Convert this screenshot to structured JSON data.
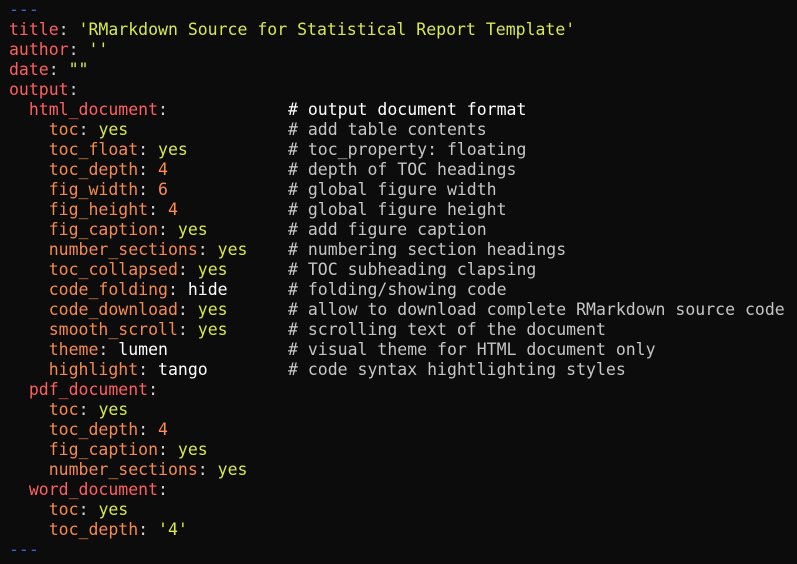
{
  "editor": {
    "lines": [
      {
        "segs": [
          {
            "t": "---",
            "c": "sep"
          }
        ]
      },
      {
        "segs": [
          {
            "t": "title",
            "c": "k"
          },
          {
            "t": ": ",
            "c": "p"
          },
          {
            "t": "'RMarkdown Source for Statistical Report Template'",
            "c": "s"
          }
        ]
      },
      {
        "segs": [
          {
            "t": "author",
            "c": "k"
          },
          {
            "t": ": ",
            "c": "p"
          },
          {
            "t": "''",
            "c": "s"
          }
        ]
      },
      {
        "segs": [
          {
            "t": "date",
            "c": "k"
          },
          {
            "t": ": ",
            "c": "p"
          },
          {
            "t": "\"\"",
            "c": "s"
          }
        ]
      },
      {
        "segs": [
          {
            "t": "output",
            "c": "k"
          },
          {
            "t": ":",
            "c": "p"
          }
        ]
      },
      {
        "segs": [
          {
            "t": "  ",
            "c": "p"
          },
          {
            "t": "html_document",
            "c": "k"
          },
          {
            "t": ":",
            "c": "p"
          }
        ],
        "comment": "# output document format",
        "bright": true
      },
      {
        "segs": [
          {
            "t": "    ",
            "c": "p"
          },
          {
            "t": "toc",
            "c": "k2"
          },
          {
            "t": ": ",
            "c": "p"
          },
          {
            "t": "yes",
            "c": "b"
          }
        ],
        "comment": "# add table contents"
      },
      {
        "segs": [
          {
            "t": "    ",
            "c": "p"
          },
          {
            "t": "toc_float",
            "c": "k2"
          },
          {
            "t": ": ",
            "c": "p"
          },
          {
            "t": "yes",
            "c": "b"
          }
        ],
        "comment": "# toc_property: floating"
      },
      {
        "segs": [
          {
            "t": "    ",
            "c": "p"
          },
          {
            "t": "toc_depth",
            "c": "k2"
          },
          {
            "t": ": ",
            "c": "p"
          },
          {
            "t": "4",
            "c": "n"
          }
        ],
        "comment": "# depth of TOC headings"
      },
      {
        "segs": [
          {
            "t": "    ",
            "c": "p"
          },
          {
            "t": "fig_width",
            "c": "k2"
          },
          {
            "t": ": ",
            "c": "p"
          },
          {
            "t": "6",
            "c": "n"
          }
        ],
        "comment": "# global figure width"
      },
      {
        "segs": [
          {
            "t": "    ",
            "c": "p"
          },
          {
            "t": "fig_height",
            "c": "k2"
          },
          {
            "t": ": ",
            "c": "p"
          },
          {
            "t": "4",
            "c": "n"
          }
        ],
        "comment": "# global figure height"
      },
      {
        "segs": [
          {
            "t": "    ",
            "c": "p"
          },
          {
            "t": "fig_caption",
            "c": "k2"
          },
          {
            "t": ": ",
            "c": "p"
          },
          {
            "t": "yes",
            "c": "b"
          }
        ],
        "comment": "# add figure caption"
      },
      {
        "segs": [
          {
            "t": "    ",
            "c": "p"
          },
          {
            "t": "number_sections",
            "c": "k2"
          },
          {
            "t": ": ",
            "c": "p"
          },
          {
            "t": "yes",
            "c": "b"
          }
        ],
        "comment": "# numbering section headings"
      },
      {
        "segs": [
          {
            "t": "    ",
            "c": "p"
          },
          {
            "t": "toc_collapsed",
            "c": "k2"
          },
          {
            "t": ": ",
            "c": "p"
          },
          {
            "t": "yes",
            "c": "b"
          }
        ],
        "comment": "# TOC subheading clapsing"
      },
      {
        "segs": [
          {
            "t": "    ",
            "c": "p"
          },
          {
            "t": "code_folding",
            "c": "k2"
          },
          {
            "t": ": ",
            "c": "p"
          },
          {
            "t": "hide",
            "c": "w"
          }
        ],
        "comment": "# folding/showing code"
      },
      {
        "segs": [
          {
            "t": "    ",
            "c": "p"
          },
          {
            "t": "code_download",
            "c": "k2"
          },
          {
            "t": ": ",
            "c": "p"
          },
          {
            "t": "yes",
            "c": "b"
          }
        ],
        "comment": "# allow to download complete RMarkdown source code"
      },
      {
        "segs": [
          {
            "t": "    ",
            "c": "p"
          },
          {
            "t": "smooth_scroll",
            "c": "k2"
          },
          {
            "t": ": ",
            "c": "p"
          },
          {
            "t": "yes",
            "c": "b"
          }
        ],
        "comment": "# scrolling text of the document"
      },
      {
        "segs": [
          {
            "t": "    ",
            "c": "p"
          },
          {
            "t": "theme",
            "c": "k2"
          },
          {
            "t": ": ",
            "c": "p"
          },
          {
            "t": "lumen",
            "c": "w"
          }
        ],
        "comment": "# visual theme for HTML document only"
      },
      {
        "segs": [
          {
            "t": "    ",
            "c": "p"
          },
          {
            "t": "highlight",
            "c": "k2"
          },
          {
            "t": ": ",
            "c": "p"
          },
          {
            "t": "tango",
            "c": "w"
          }
        ],
        "comment": "# code syntax hightlighting styles"
      },
      {
        "segs": [
          {
            "t": "  ",
            "c": "p"
          },
          {
            "t": "pdf_document",
            "c": "k"
          },
          {
            "t": ":",
            "c": "p"
          }
        ]
      },
      {
        "segs": [
          {
            "t": "    ",
            "c": "p"
          },
          {
            "t": "toc",
            "c": "k2"
          },
          {
            "t": ": ",
            "c": "p"
          },
          {
            "t": "yes",
            "c": "b"
          }
        ]
      },
      {
        "segs": [
          {
            "t": "    ",
            "c": "p"
          },
          {
            "t": "toc_depth",
            "c": "k2"
          },
          {
            "t": ": ",
            "c": "p"
          },
          {
            "t": "4",
            "c": "n"
          }
        ]
      },
      {
        "segs": [
          {
            "t": "    ",
            "c": "p"
          },
          {
            "t": "fig_caption",
            "c": "k2"
          },
          {
            "t": ": ",
            "c": "p"
          },
          {
            "t": "yes",
            "c": "b"
          }
        ]
      },
      {
        "segs": [
          {
            "t": "    ",
            "c": "p"
          },
          {
            "t": "number_sections",
            "c": "k2"
          },
          {
            "t": ": ",
            "c": "p"
          },
          {
            "t": "yes",
            "c": "b"
          }
        ]
      },
      {
        "segs": [
          {
            "t": "  ",
            "c": "p"
          },
          {
            "t": "word_document",
            "c": "k"
          },
          {
            "t": ":",
            "c": "p"
          }
        ]
      },
      {
        "segs": [
          {
            "t": "    ",
            "c": "p"
          },
          {
            "t": "toc",
            "c": "k2"
          },
          {
            "t": ": ",
            "c": "p"
          },
          {
            "t": "yes",
            "c": "b"
          }
        ]
      },
      {
        "segs": [
          {
            "t": "    ",
            "c": "p"
          },
          {
            "t": "toc_depth",
            "c": "k2"
          },
          {
            "t": ": ",
            "c": "p"
          },
          {
            "t": "'4'",
            "c": "s"
          }
        ]
      },
      {
        "segs": [
          {
            "t": "---",
            "c": "sep"
          }
        ]
      }
    ]
  },
  "colors": {
    "background": "#0c0c0c",
    "separator": "#3f62d0",
    "top_key": "#ff5f5f",
    "nested_key": "#f58a4d",
    "string": "#d9e94a",
    "number": "#ff8c4c",
    "comment": "#c5c5c5"
  }
}
